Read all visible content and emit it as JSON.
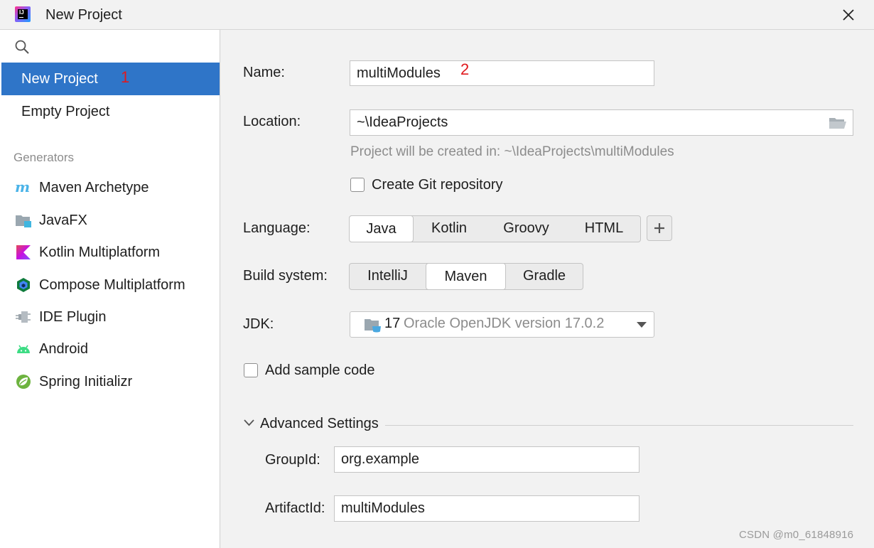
{
  "window": {
    "title": "New Project"
  },
  "sidebar": {
    "items": [
      {
        "label": "New Project",
        "selected": true,
        "annotation": "1"
      },
      {
        "label": "Empty Project",
        "selected": false
      }
    ],
    "generators_label": "Generators",
    "generators": [
      {
        "label": "Maven Archetype",
        "icon": "maven-icon"
      },
      {
        "label": "JavaFX",
        "icon": "javafx-icon"
      },
      {
        "label": "Kotlin Multiplatform",
        "icon": "kotlin-icon"
      },
      {
        "label": "Compose Multiplatform",
        "icon": "compose-icon"
      },
      {
        "label": "IDE Plugin",
        "icon": "plugin-icon"
      },
      {
        "label": "Android",
        "icon": "android-icon"
      },
      {
        "label": "Spring Initializr",
        "icon": "spring-icon"
      }
    ]
  },
  "form": {
    "name": {
      "label": "Name:",
      "value": "multiModules",
      "annotation": "2"
    },
    "location": {
      "label": "Location:",
      "value": "~\\IdeaProjects",
      "hint": "Project will be created in: ~\\IdeaProjects\\multiModules"
    },
    "git": {
      "label": "Create Git repository",
      "checked": false
    },
    "language": {
      "label": "Language:",
      "options": [
        "Java",
        "Kotlin",
        "Groovy",
        "HTML"
      ],
      "selected": "Java"
    },
    "build_system": {
      "label": "Build system:",
      "options": [
        "IntelliJ",
        "Maven",
        "Gradle"
      ],
      "selected": "Maven"
    },
    "jdk": {
      "label": "JDK:",
      "version": "17",
      "description": "Oracle OpenJDK version 17.0.2"
    },
    "sample_code": {
      "label": "Add sample code",
      "checked": false
    },
    "advanced": {
      "title": "Advanced Settings",
      "expanded": true,
      "group_id": {
        "label": "GroupId:",
        "value": "org.example"
      },
      "artifact_id": {
        "label": "ArtifactId:",
        "value": "multiModules"
      }
    }
  },
  "watermark": "CSDN @m0_61848916",
  "colors": {
    "accent": "#2f75c8",
    "annotation": "#e0191e",
    "hint": "#8c8c8c"
  }
}
